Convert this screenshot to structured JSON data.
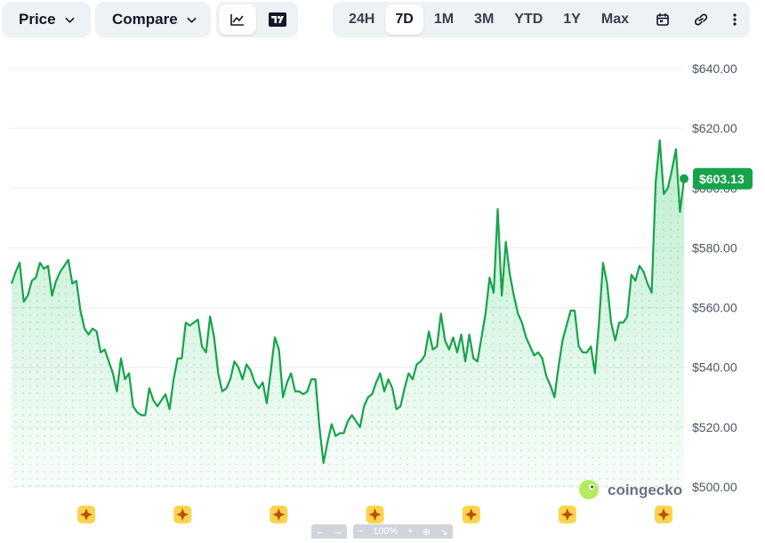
{
  "toolbar": {
    "price_label": "Price",
    "compare_label": "Compare",
    "chart_type_buttons": [
      {
        "icon": "line-chart-icon",
        "active": true
      },
      {
        "icon": "tradingview-icon",
        "active": false
      }
    ],
    "ranges": [
      "24H",
      "7D",
      "1M",
      "3M",
      "YTD",
      "1Y",
      "Max"
    ],
    "active_range": "7D",
    "tool_icons": [
      "calendar-icon",
      "link-icon",
      "more-vertical-icon"
    ]
  },
  "current_price_label": "$603.13",
  "watermark": "coingecko",
  "navigator": {
    "zoom": "100%",
    "buttons": [
      "←",
      "→",
      "−",
      "+"
    ]
  },
  "colors": {
    "line": "#16a34a",
    "badge": "#16a34a",
    "fill_top": "#22c55e",
    "toolbar_bg": "#eff2f5",
    "event_marker": "#fcd34d"
  },
  "chart_data": {
    "type": "area",
    "title": "",
    "xlabel": "",
    "ylabel": "",
    "y_axis_position": "right",
    "y_ticks": [
      "$640.00",
      "$620.00",
      "$600.00",
      "$580.00",
      "$560.00",
      "$540.00",
      "$520.00",
      "$500.00"
    ],
    "y_tick_values": [
      640,
      620,
      600,
      580,
      560,
      540,
      520,
      500
    ],
    "ylim": [
      500,
      640
    ],
    "grid": true,
    "last_value": 603.13,
    "event_markers": 7,
    "series": [
      {
        "values": [
          568,
          572,
          575,
          562,
          564,
          569,
          570,
          575,
          573,
          574,
          564,
          569,
          572,
          574,
          576,
          568,
          569,
          559,
          553,
          551,
          553,
          552,
          545,
          546,
          542,
          538,
          532,
          543,
          536,
          538,
          527,
          525,
          524,
          524,
          533,
          529,
          527,
          529,
          531,
          526,
          536,
          543,
          543,
          555,
          554,
          555,
          556,
          547,
          545,
          557,
          550,
          538,
          532,
          533,
          536,
          542,
          540,
          536,
          541,
          539,
          535,
          533,
          535,
          528,
          539,
          550,
          546,
          530,
          535,
          538,
          532,
          532,
          531,
          532,
          536,
          536,
          520,
          508,
          515,
          521,
          517,
          518,
          518,
          522,
          524,
          522,
          520,
          527,
          530,
          531,
          535,
          538,
          532,
          536,
          533,
          526,
          527,
          533,
          538,
          536,
          541,
          542,
          544,
          552,
          546,
          547,
          558,
          549,
          546,
          550,
          545,
          551,
          542,
          551,
          543,
          542,
          550,
          558,
          570,
          565,
          593,
          564,
          582,
          571,
          564,
          558,
          555,
          550,
          547,
          544,
          545,
          543,
          537,
          534,
          530,
          540,
          549,
          554,
          559,
          559,
          547,
          545,
          545,
          547,
          538,
          555,
          575,
          568,
          555,
          549,
          555,
          555,
          557,
          571,
          569,
          574,
          572,
          568,
          565,
          602,
          616,
          598,
          600,
          606,
          613,
          592,
          603.13
        ]
      }
    ]
  }
}
